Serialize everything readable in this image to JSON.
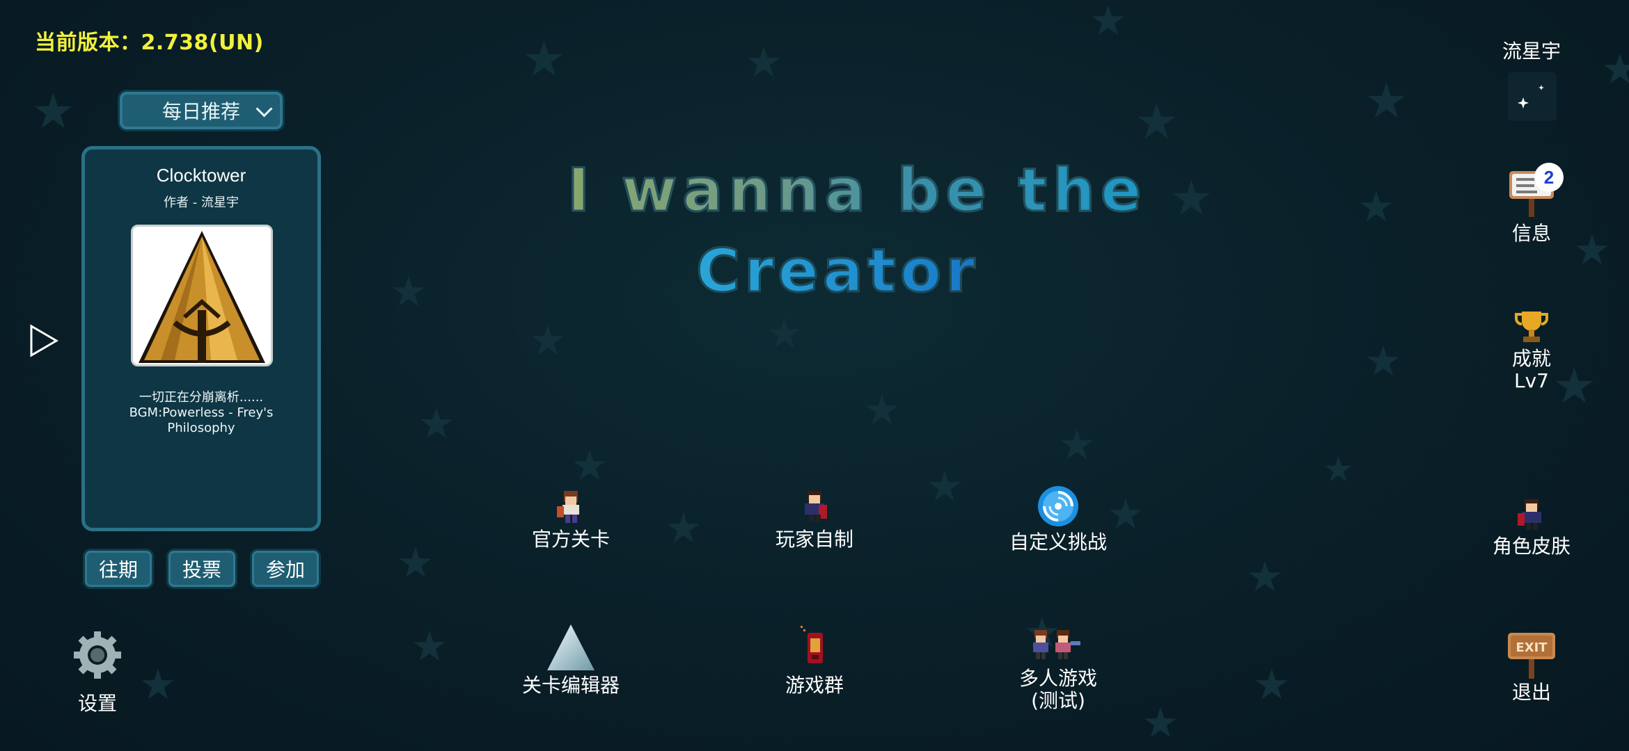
{
  "version_text": "当前版本：2.738(UN)",
  "daily": {
    "dropdown_label": "每日推荐",
    "level": {
      "title": "Clocktower",
      "author": "作者 - 流星宇",
      "description": "一切正在分崩离析......\nBGM:Powerless - Frey's\nPhilosophy"
    },
    "buttons": {
      "past": "往期",
      "vote": "投票",
      "join": "参加"
    }
  },
  "game_title": {
    "line1": "I wanna be the",
    "line2": "Creator"
  },
  "menu": {
    "official_levels": "官方关卡",
    "player_made": "玩家自制",
    "custom_challenge": "自定义挑战",
    "level_editor": "关卡编辑器",
    "game_group": "游戏群",
    "multiplayer": "多人游戏\n(测试)"
  },
  "user": {
    "name": "流星宇",
    "messages_label": "信息",
    "messages_count": "2",
    "achievements_label": "成就",
    "achievements_level": "Lv7",
    "skins_label": "角色皮肤",
    "exit_label": "退出",
    "exit_sign_text": "EXIT"
  },
  "settings_label": "设置",
  "colors": {
    "version_yellow": "#f1f13c",
    "panel_border": "#2b7188",
    "button_bg": "#1f5d72",
    "badge_text": "#1a3fd4"
  }
}
